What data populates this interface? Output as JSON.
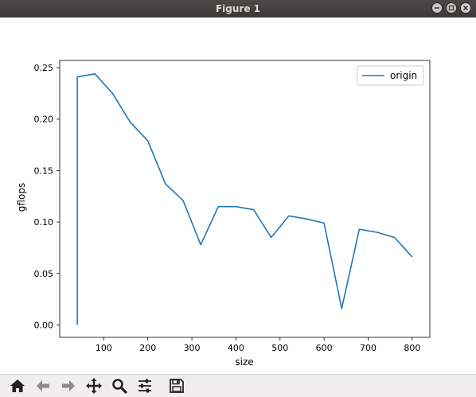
{
  "window": {
    "title": "Figure 1"
  },
  "toolbar": {
    "buttons": [
      {
        "name": "home-button",
        "icon": "home-icon"
      },
      {
        "name": "back-button",
        "icon": "arrow-left-icon"
      },
      {
        "name": "forward-button",
        "icon": "arrow-right-icon"
      },
      {
        "name": "pan-button",
        "icon": "move-icon"
      },
      {
        "name": "zoom-button",
        "icon": "search-icon"
      },
      {
        "name": "configure-subplots-button",
        "icon": "sliders-icon"
      },
      {
        "name": "save-button",
        "icon": "save-icon"
      }
    ]
  },
  "chart_data": {
    "type": "line",
    "xlabel": "size",
    "ylabel": "gflops",
    "xlim": [
      0,
      840
    ],
    "ylim": [
      -0.012,
      0.257
    ],
    "xticks": [
      100,
      200,
      300,
      400,
      500,
      600,
      700,
      800
    ],
    "yticks": [
      0.0,
      0.05,
      0.1,
      0.15,
      0.2,
      0.25
    ],
    "ytick_labels": [
      "0.00",
      "0.05",
      "0.10",
      "0.15",
      "0.20",
      "0.25"
    ],
    "grid": false,
    "legend_position": "top-right",
    "series": [
      {
        "name": "origin",
        "color": "#1f77b4",
        "x": [
          40,
          40,
          80,
          120,
          160,
          200,
          240,
          280,
          320,
          360,
          400,
          440,
          480,
          520,
          560,
          600,
          640,
          680,
          720,
          760,
          800
        ],
        "y": [
          0.0,
          0.241,
          0.244,
          0.225,
          0.197,
          0.179,
          0.137,
          0.121,
          0.078,
          0.115,
          0.115,
          0.112,
          0.085,
          0.106,
          0.103,
          0.099,
          0.016,
          0.093,
          0.09,
          0.085,
          0.066
        ]
      }
    ]
  }
}
